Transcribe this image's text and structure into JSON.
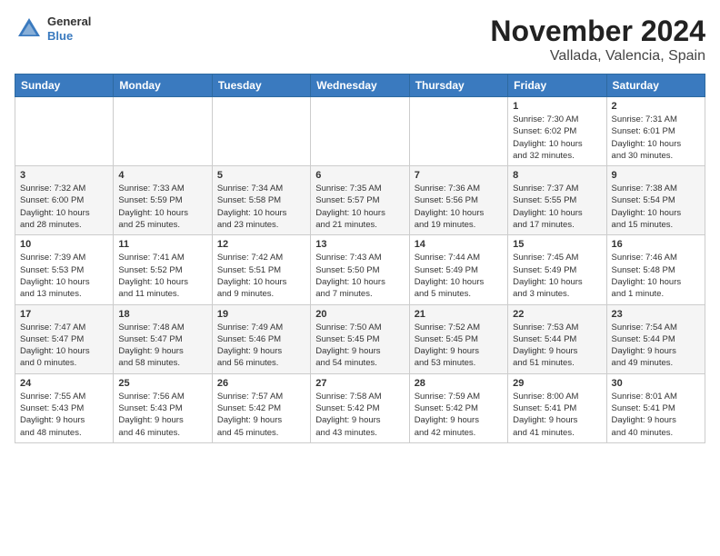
{
  "logo": {
    "general": "General",
    "blue": "Blue"
  },
  "title": "November 2024",
  "subtitle": "Vallada, Valencia, Spain",
  "days_of_week": [
    "Sunday",
    "Monday",
    "Tuesday",
    "Wednesday",
    "Thursday",
    "Friday",
    "Saturday"
  ],
  "weeks": [
    [
      {
        "day": "",
        "info": ""
      },
      {
        "day": "",
        "info": ""
      },
      {
        "day": "",
        "info": ""
      },
      {
        "day": "",
        "info": ""
      },
      {
        "day": "",
        "info": ""
      },
      {
        "day": "1",
        "info": "Sunrise: 7:30 AM\nSunset: 6:02 PM\nDaylight: 10 hours\nand 32 minutes."
      },
      {
        "day": "2",
        "info": "Sunrise: 7:31 AM\nSunset: 6:01 PM\nDaylight: 10 hours\nand 30 minutes."
      }
    ],
    [
      {
        "day": "3",
        "info": "Sunrise: 7:32 AM\nSunset: 6:00 PM\nDaylight: 10 hours\nand 28 minutes."
      },
      {
        "day": "4",
        "info": "Sunrise: 7:33 AM\nSunset: 5:59 PM\nDaylight: 10 hours\nand 25 minutes."
      },
      {
        "day": "5",
        "info": "Sunrise: 7:34 AM\nSunset: 5:58 PM\nDaylight: 10 hours\nand 23 minutes."
      },
      {
        "day": "6",
        "info": "Sunrise: 7:35 AM\nSunset: 5:57 PM\nDaylight: 10 hours\nand 21 minutes."
      },
      {
        "day": "7",
        "info": "Sunrise: 7:36 AM\nSunset: 5:56 PM\nDaylight: 10 hours\nand 19 minutes."
      },
      {
        "day": "8",
        "info": "Sunrise: 7:37 AM\nSunset: 5:55 PM\nDaylight: 10 hours\nand 17 minutes."
      },
      {
        "day": "9",
        "info": "Sunrise: 7:38 AM\nSunset: 5:54 PM\nDaylight: 10 hours\nand 15 minutes."
      }
    ],
    [
      {
        "day": "10",
        "info": "Sunrise: 7:39 AM\nSunset: 5:53 PM\nDaylight: 10 hours\nand 13 minutes."
      },
      {
        "day": "11",
        "info": "Sunrise: 7:41 AM\nSunset: 5:52 PM\nDaylight: 10 hours\nand 11 minutes."
      },
      {
        "day": "12",
        "info": "Sunrise: 7:42 AM\nSunset: 5:51 PM\nDaylight: 10 hours\nand 9 minutes."
      },
      {
        "day": "13",
        "info": "Sunrise: 7:43 AM\nSunset: 5:50 PM\nDaylight: 10 hours\nand 7 minutes."
      },
      {
        "day": "14",
        "info": "Sunrise: 7:44 AM\nSunset: 5:49 PM\nDaylight: 10 hours\nand 5 minutes."
      },
      {
        "day": "15",
        "info": "Sunrise: 7:45 AM\nSunset: 5:49 PM\nDaylight: 10 hours\nand 3 minutes."
      },
      {
        "day": "16",
        "info": "Sunrise: 7:46 AM\nSunset: 5:48 PM\nDaylight: 10 hours\nand 1 minute."
      }
    ],
    [
      {
        "day": "17",
        "info": "Sunrise: 7:47 AM\nSunset: 5:47 PM\nDaylight: 10 hours\nand 0 minutes."
      },
      {
        "day": "18",
        "info": "Sunrise: 7:48 AM\nSunset: 5:47 PM\nDaylight: 9 hours\nand 58 minutes."
      },
      {
        "day": "19",
        "info": "Sunrise: 7:49 AM\nSunset: 5:46 PM\nDaylight: 9 hours\nand 56 minutes."
      },
      {
        "day": "20",
        "info": "Sunrise: 7:50 AM\nSunset: 5:45 PM\nDaylight: 9 hours\nand 54 minutes."
      },
      {
        "day": "21",
        "info": "Sunrise: 7:52 AM\nSunset: 5:45 PM\nDaylight: 9 hours\nand 53 minutes."
      },
      {
        "day": "22",
        "info": "Sunrise: 7:53 AM\nSunset: 5:44 PM\nDaylight: 9 hours\nand 51 minutes."
      },
      {
        "day": "23",
        "info": "Sunrise: 7:54 AM\nSunset: 5:44 PM\nDaylight: 9 hours\nand 49 minutes."
      }
    ],
    [
      {
        "day": "24",
        "info": "Sunrise: 7:55 AM\nSunset: 5:43 PM\nDaylight: 9 hours\nand 48 minutes."
      },
      {
        "day": "25",
        "info": "Sunrise: 7:56 AM\nSunset: 5:43 PM\nDaylight: 9 hours\nand 46 minutes."
      },
      {
        "day": "26",
        "info": "Sunrise: 7:57 AM\nSunset: 5:42 PM\nDaylight: 9 hours\nand 45 minutes."
      },
      {
        "day": "27",
        "info": "Sunrise: 7:58 AM\nSunset: 5:42 PM\nDaylight: 9 hours\nand 43 minutes."
      },
      {
        "day": "28",
        "info": "Sunrise: 7:59 AM\nSunset: 5:42 PM\nDaylight: 9 hours\nand 42 minutes."
      },
      {
        "day": "29",
        "info": "Sunrise: 8:00 AM\nSunset: 5:41 PM\nDaylight: 9 hours\nand 41 minutes."
      },
      {
        "day": "30",
        "info": "Sunrise: 8:01 AM\nSunset: 5:41 PM\nDaylight: 9 hours\nand 40 minutes."
      }
    ]
  ]
}
